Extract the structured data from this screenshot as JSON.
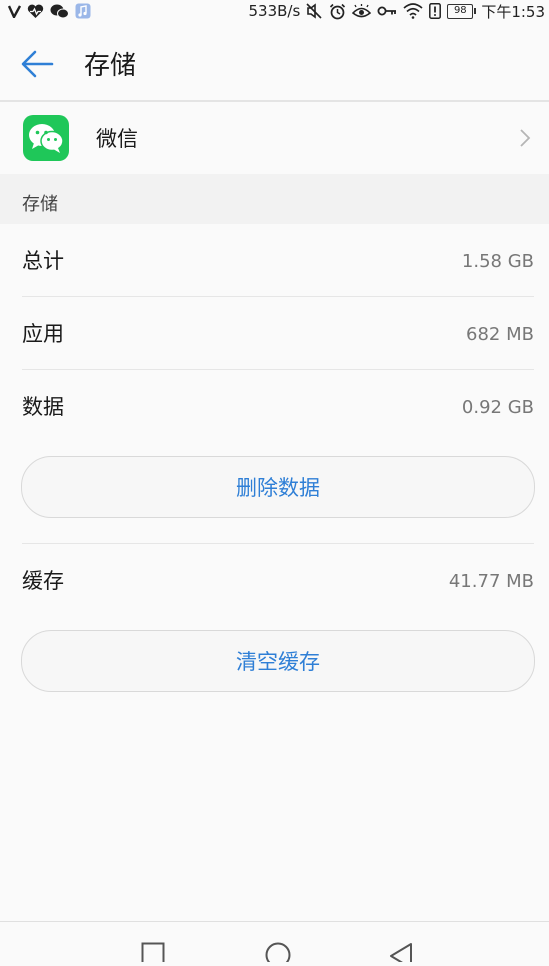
{
  "status_bar": {
    "network_speed": "533B/s",
    "battery_level": "98",
    "time": "下午1:53",
    "icons": [
      "signal-v-icon",
      "heart-icon",
      "wechat-notify-icon",
      "music-app-icon",
      "mute-icon",
      "alarm-icon",
      "eye-comfort-icon",
      "key-icon",
      "wifi-icon",
      "alert-icon",
      "battery-icon"
    ]
  },
  "header": {
    "title": "存储",
    "back_icon": "back-arrow-icon"
  },
  "app": {
    "name": "微信",
    "icon": "wechat-icon",
    "chevron_icon": "chevron-right-icon"
  },
  "storage_section": {
    "header": "存储",
    "rows": [
      {
        "label": "总计",
        "value": "1.58 GB"
      },
      {
        "label": "应用",
        "value": "682 MB"
      },
      {
        "label": "数据",
        "value": "0.92 GB"
      }
    ],
    "delete_data_label": "删除数据",
    "cache": {
      "label": "缓存",
      "value": "41.77 MB"
    },
    "clear_cache_label": "清空缓存"
  },
  "nav_bar": {
    "icons": [
      "recent-apps-icon",
      "home-icon",
      "back-triangle-icon"
    ]
  },
  "colors": {
    "accent": "#2f7fd6",
    "wechat_green": "#1fc759",
    "background": "#fafafa"
  }
}
